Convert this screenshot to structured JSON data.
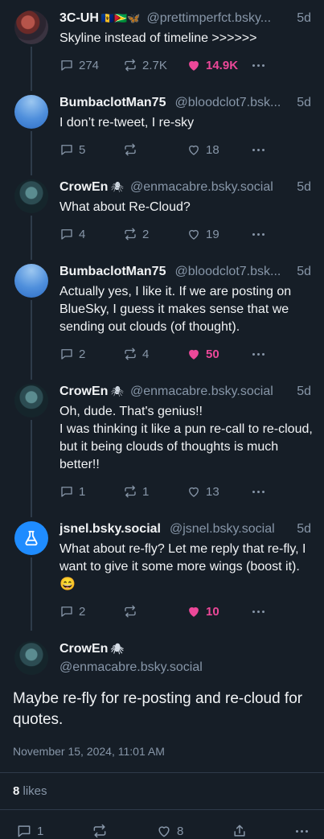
{
  "posts": [
    {
      "name": "3C-UH",
      "emoji": "🇧🇧🇬🇾🦋",
      "handle": "@prettimperfct.bsky...",
      "time": "5d",
      "text": [
        "Skyline instead of timeline >>>>>>"
      ],
      "replies": "274",
      "reposts": "2.7K",
      "likes": "14.9K",
      "liked": true,
      "avatar": "photo-avatar"
    },
    {
      "name": "BumbaclotMan75",
      "emoji": "",
      "handle": "@bloodclot7.bsk...",
      "time": "5d",
      "text": [
        "I don’t re-tweet, I re-sky"
      ],
      "replies": "5",
      "reposts": "",
      "likes": "18",
      "liked": false,
      "avatar": "sky-avatar"
    },
    {
      "name": "CrowEn",
      "emoji": "🕷",
      "handle": "@enmacabre.bsky.social",
      "time": "5d",
      "text": [
        "What about Re-Cloud?"
      ],
      "replies": "4",
      "reposts": "2",
      "likes": "19",
      "liked": false,
      "avatar": "crow-avatar"
    },
    {
      "name": "BumbaclotMan75",
      "emoji": "",
      "handle": "@bloodclot7.bsk...",
      "time": "5d",
      "text": [
        "Actually yes, I like it. If we are posting on BlueSky, I guess it makes sense that we sending out clouds (of thought)."
      ],
      "replies": "2",
      "reposts": "4",
      "likes": "50",
      "liked": true,
      "avatar": "sky-avatar"
    },
    {
      "name": "CrowEn",
      "emoji": "🕷",
      "handle": "@enmacabre.bsky.social",
      "time": "5d",
      "text": [
        "Oh, dude. That's genius!!",
        "I was thinking it like a pun re-call to re-cloud, but it being clouds of thoughts is much better!!"
      ],
      "replies": "1",
      "reposts": "1",
      "likes": "13",
      "liked": false,
      "avatar": "crow-avatar"
    },
    {
      "name": "jsnel.bsky.social",
      "emoji": "",
      "handle": "@jsnel.bsky.social",
      "time": "5d",
      "text": [
        "What about re-fly? Let me reply that re-fly, I want to give it some more wings (boost it). 😄"
      ],
      "replies": "2",
      "reposts": "",
      "likes": "10",
      "liked": true,
      "avatar": "flask-avatar"
    }
  ],
  "main_post": {
    "name": "CrowEn",
    "emoji": "🕷",
    "handle": "@enmacabre.bsky.social",
    "text": "Maybe re-fly for re-posting and re-cloud for quotes.",
    "date": "November 15, 2024, 11:01 AM",
    "likes_count": "8",
    "likes_label": "likes",
    "replies": "1",
    "likes": "8",
    "avatar": "crow-avatar"
  },
  "colors": {
    "background": "#161e27",
    "muted": "#8796a8",
    "like_pink": "#ec4899",
    "brand_blue": "#1f8cff"
  },
  "icons": {
    "reply": "speech-bubble-icon",
    "repost": "repost-arrows-icon",
    "like": "heart-icon",
    "more": "more-dots-icon",
    "share": "share-icon"
  }
}
